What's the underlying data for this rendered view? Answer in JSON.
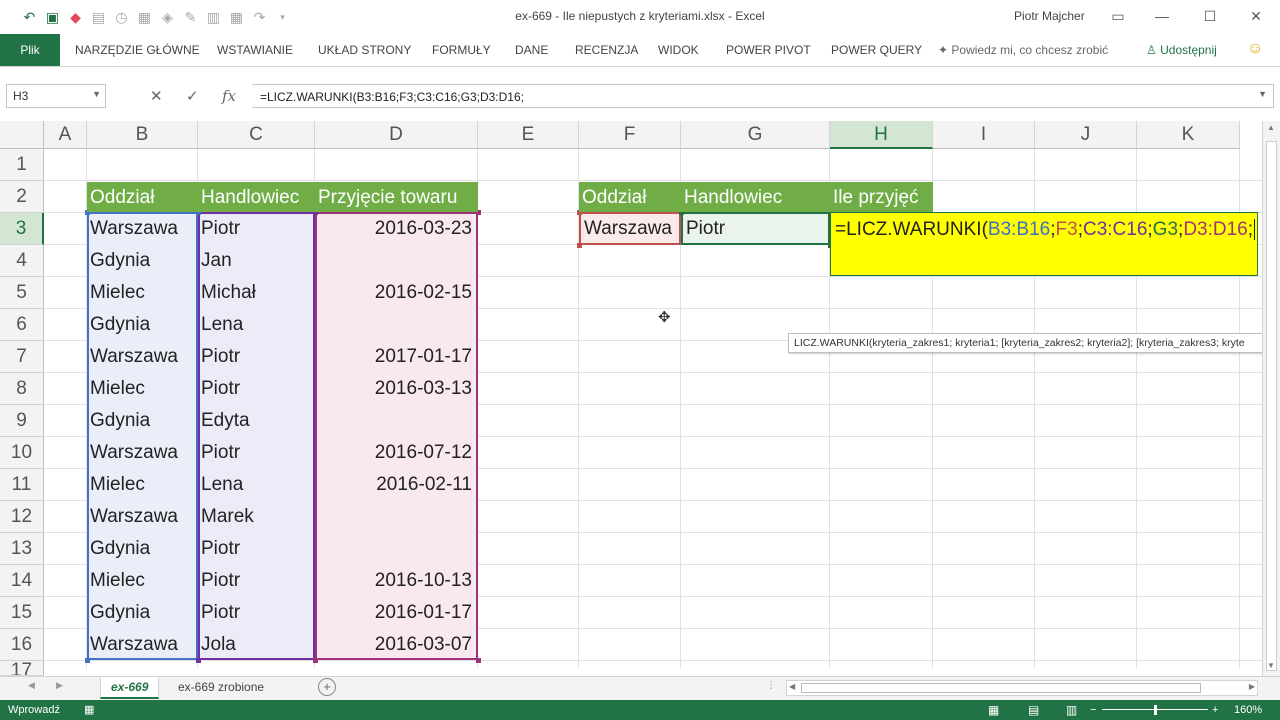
{
  "window": {
    "title": "ex-669 - Ile niepustych z kryteriami.xlsx  -  Excel",
    "user": "Piotr Majcher"
  },
  "ribbon": {
    "file_tab": "Plik",
    "tabs": [
      "NARZĘDZIE GŁÓWNE",
      "WSTAWIANIE",
      "UKŁAD STRONY",
      "FORMUŁY",
      "DANE",
      "RECENZJA",
      "WIDOK",
      "POWER PIVOT",
      "POWER QUERY"
    ],
    "tell_me": "Powiedz mi, co chcesz zrobić",
    "share": "Udostępnij"
  },
  "formula_bar": {
    "name_box": "H3",
    "formula": "=LICZ.WARUNKI(B3:B16;F3;C3:C16;G3;D3:D16;"
  },
  "columns": [
    "A",
    "B",
    "C",
    "D",
    "E",
    "F",
    "G",
    "H",
    "I",
    "J",
    "K"
  ],
  "rows": [
    "1",
    "2",
    "3",
    "4",
    "5",
    "6",
    "7",
    "8",
    "9",
    "10",
    "11",
    "12",
    "13",
    "14",
    "15",
    "16",
    "17"
  ],
  "table_headers": {
    "b": "Oddział",
    "c": "Handlowiec",
    "d": "Przyjęcie towaru"
  },
  "table_rows": [
    {
      "b": "Warszawa",
      "c": "Piotr",
      "d": "2016-03-23"
    },
    {
      "b": "Gdynia",
      "c": "Jan",
      "d": ""
    },
    {
      "b": "Mielec",
      "c": "Michał",
      "d": "2016-02-15"
    },
    {
      "b": "Gdynia",
      "c": "Lena",
      "d": ""
    },
    {
      "b": "Warszawa",
      "c": "Piotr",
      "d": "2017-01-17"
    },
    {
      "b": "Mielec",
      "c": "Piotr",
      "d": "2016-03-13"
    },
    {
      "b": "Gdynia",
      "c": "Edyta",
      "d": ""
    },
    {
      "b": "Warszawa",
      "c": "Piotr",
      "d": "2016-07-12"
    },
    {
      "b": "Mielec",
      "c": "Lena",
      "d": "2016-02-11"
    },
    {
      "b": "Warszawa",
      "c": "Marek",
      "d": ""
    },
    {
      "b": "Gdynia",
      "c": "Piotr",
      "d": ""
    },
    {
      "b": "Mielec",
      "c": "Piotr",
      "d": "2016-10-13"
    },
    {
      "b": "Gdynia",
      "c": "Piotr",
      "d": "2016-01-17"
    },
    {
      "b": "Warszawa",
      "c": "Jola",
      "d": "2016-03-07"
    }
  ],
  "criteria": {
    "header_f": "Oddział",
    "header_g": "Handlowiec",
    "header_h": "Ile przyjęć",
    "value_f": "Warszawa",
    "value_g": "Piotr"
  },
  "edit_cell": {
    "p0": "=LICZ.WARUNKI(",
    "p1": "B3:B16",
    "s1": ";",
    "p2": "F3",
    "s2": ";",
    "p3": "C3:C16",
    "s3": ";",
    "p4": "G3",
    "s4": ";",
    "p5": "D3:D16",
    "s5": ";"
  },
  "tooltip": "LICZ.WARUNKI(kryteria_zakres1; kryteria1; [kryteria_zakres2; kryteria2]; [kryteria_zakres3; kryte",
  "sheets": [
    "ex-669",
    "ex-669 zrobione"
  ],
  "status": {
    "mode": "Wprowadź",
    "zoom": "160%"
  },
  "colors": {
    "accent": "#217346",
    "header_fill": "#70ad47",
    "edit_fill": "#ffff00"
  }
}
